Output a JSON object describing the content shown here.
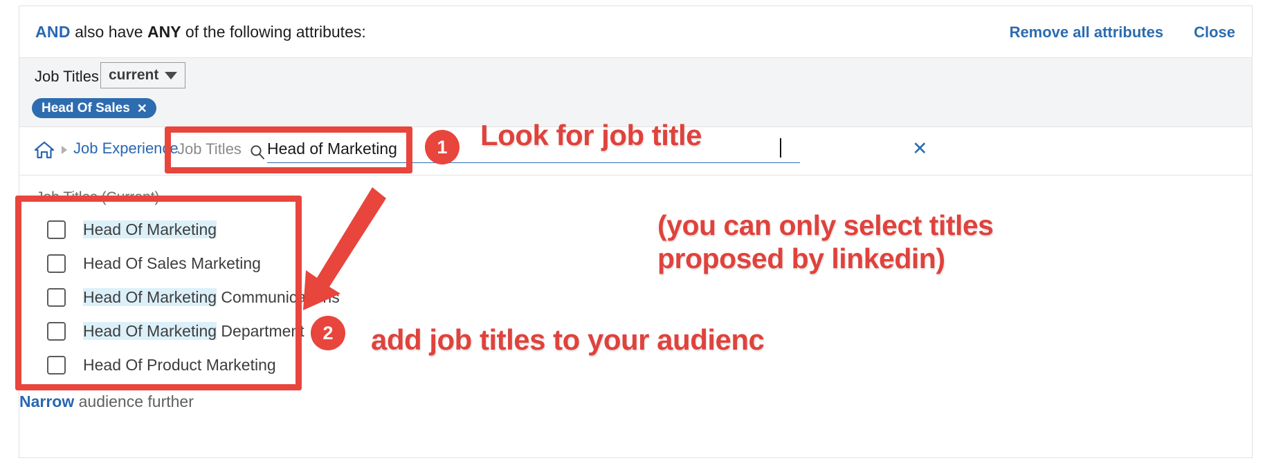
{
  "header": {
    "and": "AND",
    "middle_pre": " also have ",
    "any": "ANY",
    "middle_post": " of the following attributes:",
    "remove_all_label": "Remove all attributes",
    "close_label": "Close"
  },
  "facet": {
    "label": "Job Titles",
    "select_value": "current",
    "select_icon": "chevron-down-icon",
    "pill": {
      "label": "Head Of Sales",
      "remove_icon": "close-icon"
    }
  },
  "breadcrumb": {
    "home_icon": "home-icon",
    "separator_icon": "chevron-right-icon",
    "link": "Job Experience"
  },
  "search": {
    "label": "Job Titles",
    "icon": "search-icon",
    "value": "Head of Marketing",
    "placeholder": "Job Titles",
    "clear_icon": "close-icon"
  },
  "results": {
    "group_header": "Job Titles (Current)",
    "options": [
      {
        "highlight": "Head Of Marketing",
        "rest": ""
      },
      {
        "highlight": "",
        "rest": "Head Of Sales Marketing"
      },
      {
        "highlight": "Head Of Marketing",
        "rest": " Communications"
      },
      {
        "highlight": "Head Of Marketing",
        "rest": " Department"
      },
      {
        "highlight": "",
        "rest": "Head Of Product Marketing"
      }
    ]
  },
  "footer": {
    "narrow_link": "Narrow",
    "narrow_rest": " audience further"
  },
  "annotations": {
    "badge1": "1",
    "badge2": "2",
    "step1_text": "Look for job title",
    "note_line1": "(you can only select titles",
    "note_line2": "proposed by linkedin)",
    "step2_text": "add job titles to your audienc",
    "accent_color": "#e8453c"
  }
}
